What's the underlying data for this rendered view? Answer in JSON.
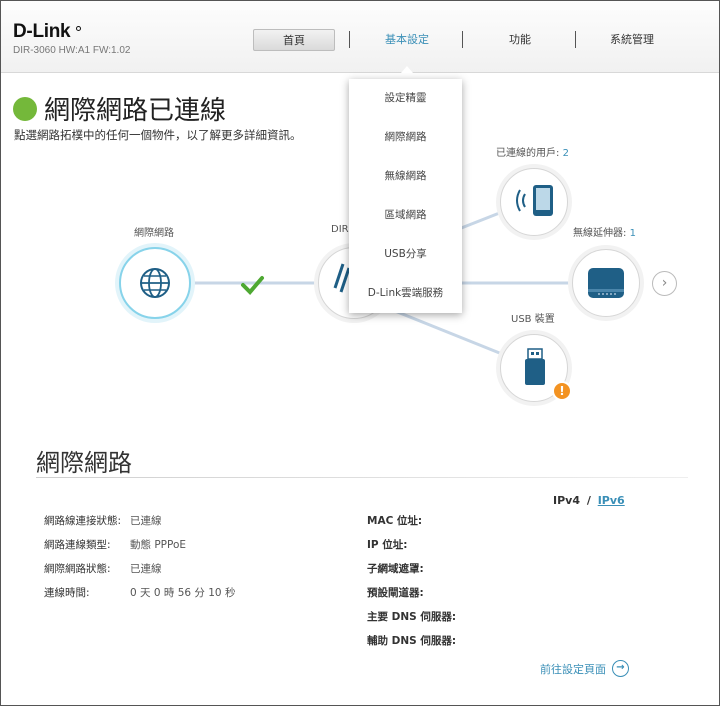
{
  "header": {
    "brand": "D-Link",
    "model": "DIR-3060 HW:A1 FW:1.02",
    "nav": {
      "home": "首頁",
      "basic": "基本設定",
      "features": "功能",
      "system": "系統管理"
    }
  },
  "dropdown": {
    "items": [
      "設定精靈",
      "網際網路",
      "無線網路",
      "區域網路",
      "USB分享",
      "D-Link雲端服務"
    ]
  },
  "status": {
    "title": "網際網路已連線",
    "subtitle": "點選網路拓樸中的任何一個物件，以了解更多詳細資訊。",
    "color": "#74b83a"
  },
  "topology": {
    "internet_label": "網際網路",
    "router_label": "DIR",
    "clients_label": "已連線的用戶: ",
    "clients_count": "2",
    "extender_label": "無線延伸器: ",
    "extender_count": "1",
    "usb_label": "USB 裝置",
    "warning_mark": "!"
  },
  "internet": {
    "title": "網際網路",
    "ipv4": "IPv4",
    "separator": "/",
    "ipv6": "IPv6",
    "left_rows": [
      {
        "label": "網路線連接狀態:",
        "value": "已連線"
      },
      {
        "label": "網路連線類型:",
        "value": "動態 PPPoE"
      },
      {
        "label": "網際網路狀態:",
        "value": "已連線"
      },
      {
        "label": "連線時間:",
        "value": "0 天 0 時 56 分 10 秒"
      }
    ],
    "right_labels": [
      "MAC 位址:",
      "IP 位址:",
      "子網域遮罩:",
      "預設閘道器:",
      "主要 DNS 伺服器:",
      "輔助 DNS 伺服器:"
    ],
    "goto_settings": "前往設定頁面"
  },
  "colors": {
    "accent": "#3a8fb7",
    "connected": "#74b83a",
    "warning": "#f39322",
    "line": "#c7d6e6"
  }
}
